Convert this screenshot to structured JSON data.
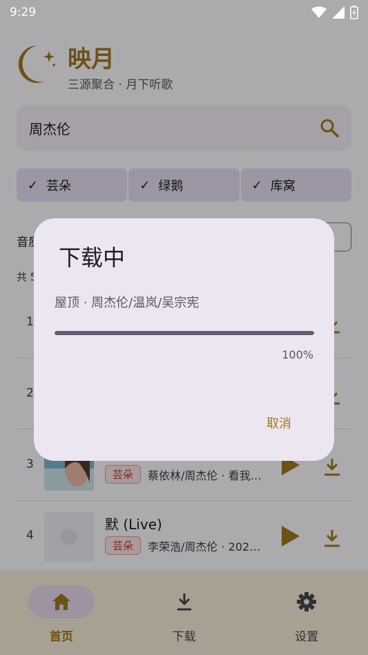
{
  "status_bar": {
    "time": "9:29"
  },
  "header": {
    "title": "映月",
    "subtitle": "三源聚合 · 月下听歌"
  },
  "search": {
    "value": "周杰伦"
  },
  "sources": [
    {
      "label": "芸朵",
      "checked": true
    },
    {
      "label": "绿鹅",
      "checked": true
    },
    {
      "label": "库窝",
      "checked": true
    }
  ],
  "quality": {
    "label": "音质"
  },
  "results": {
    "count_text": "共 5"
  },
  "rows": [
    {
      "index": "1",
      "title": "",
      "tag": "",
      "meta": ""
    },
    {
      "index": "2",
      "title": "",
      "tag": "",
      "meta": ""
    },
    {
      "index": "3",
      "title": "",
      "tag": "芸朵",
      "meta": "蔡依林/周杰伦 · 看我…"
    },
    {
      "index": "4",
      "title": "默 (Live)",
      "tag": "芸朵",
      "meta": "李荣浩/周杰伦 · 202…"
    }
  ],
  "bottom_nav": [
    {
      "label": "首页",
      "icon": "home-icon",
      "active": true
    },
    {
      "label": "下载",
      "icon": "download-icon",
      "active": false
    },
    {
      "label": "设置",
      "icon": "gear-icon",
      "active": false
    }
  ],
  "dialog": {
    "title": "下载中",
    "song": "屋顶 · 周杰伦/温岚/吴宗宪",
    "progress": 1.0,
    "progress_text": "100%",
    "cancel_label": "取消"
  },
  "colors": {
    "accent": "#a07a1e",
    "dialog_bg": "#ece6f0",
    "chip_bg": "#e6ddf2",
    "nav_bg": "#f5eed8",
    "progress": "#625b71"
  }
}
